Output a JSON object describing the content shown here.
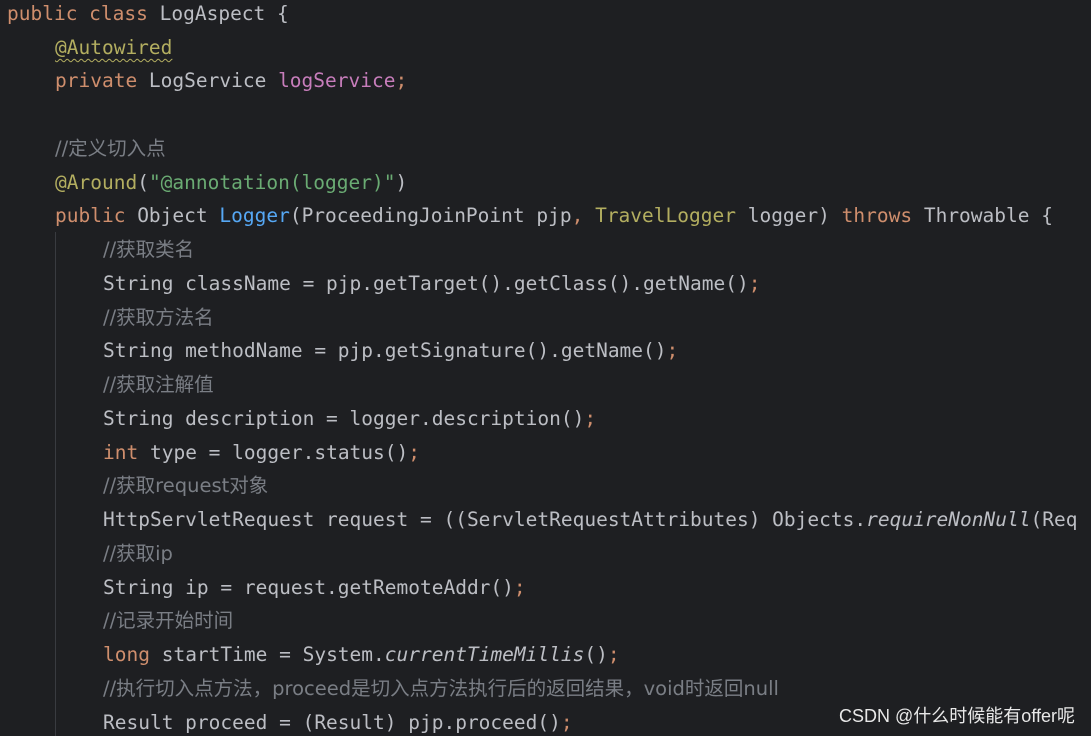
{
  "code": {
    "l1": {
      "kw": "public class ",
      "name": "LogAspect {"
    },
    "l2": {
      "ann": "@Autowired"
    },
    "l3": {
      "kw": "private ",
      "type": "LogService ",
      "field": "logService",
      "semi": ";"
    },
    "l5": {
      "comment": "//定义切入点"
    },
    "l6": {
      "ann": "@Around",
      "p1": "(",
      "str": "\"@annotation(logger)\"",
      "p2": ")"
    },
    "l7": {
      "kw1": "public ",
      "t1": "Object ",
      "fn": "Logger",
      "t2": "(ProceedingJoinPoint pjp",
      "comma": ", ",
      "ann": "TravelLogger",
      "t3": " logger) ",
      "kw2": "throws",
      "t4": " Throwable {"
    },
    "l8": {
      "comment": "//获取类名"
    },
    "l9": {
      "code": "String className = pjp.getTarget().getClass().getName()",
      "semi": ";"
    },
    "l10": {
      "comment": "//获取方法名"
    },
    "l11": {
      "code": "String methodName = pjp.getSignature().getName()",
      "semi": ";"
    },
    "l12": {
      "comment": "//获取注解值"
    },
    "l13": {
      "code": "String description = logger.description()",
      "semi": ";"
    },
    "l14": {
      "kw": "int",
      "code": " type = logger.status()",
      "semi": ";"
    },
    "l15": {
      "comment": "//获取request对象"
    },
    "l16": {
      "code": "HttpServletRequest request = ((ServletRequestAttributes) Objects.",
      "it": "requireNonNull",
      "tail": "(Req"
    },
    "l17": {
      "comment": "//获取ip"
    },
    "l18": {
      "code": "String ip = request.getRemoteAddr()",
      "semi": ";"
    },
    "l19": {
      "comment": "//记录开始时间"
    },
    "l20": {
      "kw": "long",
      "code": " startTime = System.",
      "it": "currentTimeMillis",
      "tail": "()",
      "semi": ";"
    },
    "l21": {
      "comment": "//执行切入点方法，proceed是切入点方法执行后的返回结果，void时返回null"
    },
    "l22": {
      "code": "Result proceed = (Result) pjp.proceed()",
      "semi": ";"
    }
  },
  "watermark": "CSDN @什么时候能有offer呢",
  "colors": {
    "background": "#1e1f22",
    "text": "#bcbec4",
    "keyword": "#cf8e6d",
    "annotation": "#b3ae60",
    "field": "#c77dbb",
    "string": "#6aab73",
    "comment": "#7a7e85",
    "method_decl": "#56a8f5"
  }
}
